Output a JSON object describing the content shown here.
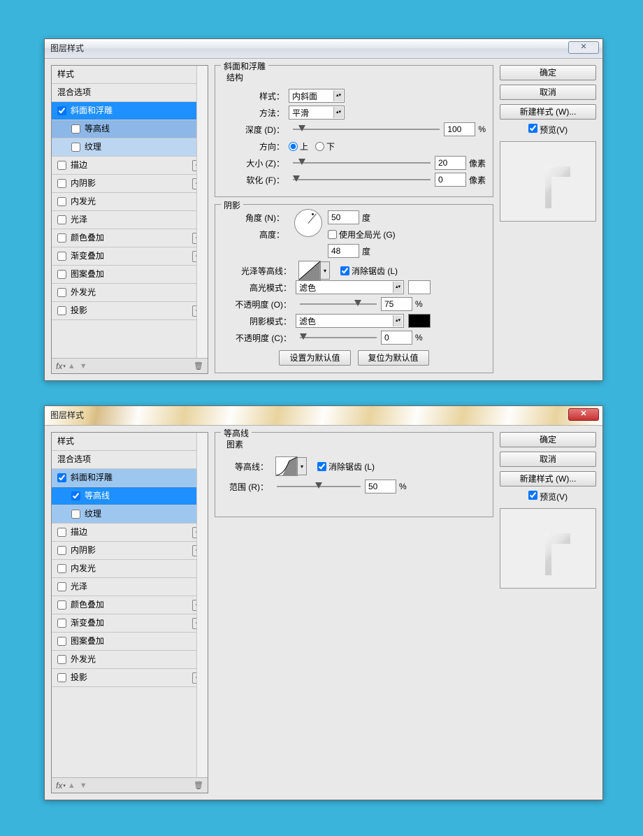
{
  "dialog1": {
    "title": "图层样式",
    "close_symbol": "✕",
    "styles_panel": {
      "header_styles": "样式",
      "header_blend": "混合选项",
      "items": [
        {
          "label": "斜面和浮雕",
          "checked": true,
          "selected": true,
          "indent": false,
          "plus": false
        },
        {
          "label": "等高线",
          "checked": false,
          "selected": false,
          "indent": true,
          "plus": false
        },
        {
          "label": "纹理",
          "checked": false,
          "selected": false,
          "indent": true,
          "plus": false
        },
        {
          "label": "描边",
          "checked": false,
          "plus": true
        },
        {
          "label": "内阴影",
          "checked": false,
          "plus": true
        },
        {
          "label": "内发光",
          "checked": false,
          "plus": false
        },
        {
          "label": "光泽",
          "checked": false,
          "plus": false
        },
        {
          "label": "颜色叠加",
          "checked": false,
          "plus": true
        },
        {
          "label": "渐变叠加",
          "checked": false,
          "plus": true
        },
        {
          "label": "图案叠加",
          "checked": false,
          "plus": false
        },
        {
          "label": "外发光",
          "checked": false,
          "plus": false
        },
        {
          "label": "投影",
          "checked": false,
          "plus": true
        }
      ],
      "fx": "fx"
    },
    "bevel": {
      "fieldset_title": "斜面和浮雕",
      "structure_title": "结构",
      "style_label": "样式：",
      "style_value": "内斜面",
      "method_label": "方法：",
      "method_value": "平滑",
      "depth_label": "深度 (D)：",
      "depth_value": "100",
      "depth_unit": "%",
      "direction_label": "方向：",
      "dir_up": "上",
      "dir_down": "下",
      "size_label": "大小 (Z)：",
      "size_value": "20",
      "size_unit": "像素",
      "soften_label": "软化 (F)：",
      "soften_value": "0",
      "soften_unit": "像素"
    },
    "shade": {
      "fieldset_title": "阴影",
      "angle_label": "角度 (N)：",
      "angle_value": "50",
      "angle_unit": "度",
      "global_light": "使用全局光 (G)",
      "altitude_label": "高度：",
      "altitude_value": "48",
      "altitude_unit": "度",
      "gloss_label": "光泽等高线：",
      "antialias": "消除锯齿 (L)",
      "highlight_mode_label": "高光模式：",
      "highlight_mode_value": "滤色",
      "highlight_color": "#ffffff",
      "highlight_opacity_label": "不透明度 (O)：",
      "highlight_opacity_value": "75",
      "shadow_mode_label": "阴影模式：",
      "shadow_mode_value": "滤色",
      "shadow_color": "#000000",
      "shadow_opacity_label": "不透明度 (C)：",
      "shadow_opacity_value": "0",
      "pct": "%"
    },
    "buttons": {
      "default": "设置为默认值",
      "reset": "复位为默认值"
    },
    "right": {
      "ok": "确定",
      "cancel": "取消",
      "new_style": "新建样式 (W)...",
      "preview": "预览(V)"
    }
  },
  "dialog2": {
    "title": "图层样式",
    "close_symbol": "✕",
    "styles_panel": {
      "header_styles": "样式",
      "header_blend": "混合选项",
      "items": [
        {
          "label": "斜面和浮雕",
          "checked": true,
          "selected": false,
          "indent": false,
          "plus": false,
          "faint": true
        },
        {
          "label": "等高线",
          "checked": true,
          "selected": true,
          "indent": true,
          "plus": false
        },
        {
          "label": "纹理",
          "checked": false,
          "selected": false,
          "indent": true,
          "plus": false,
          "faint": true
        },
        {
          "label": "描边",
          "checked": false,
          "plus": true
        },
        {
          "label": "内阴影",
          "checked": false,
          "plus": true
        },
        {
          "label": "内发光",
          "checked": false,
          "plus": false
        },
        {
          "label": "光泽",
          "checked": false,
          "plus": false
        },
        {
          "label": "颜色叠加",
          "checked": false,
          "plus": true
        },
        {
          "label": "渐变叠加",
          "checked": false,
          "plus": true
        },
        {
          "label": "图案叠加",
          "checked": false,
          "plus": false
        },
        {
          "label": "外发光",
          "checked": false,
          "plus": false
        },
        {
          "label": "投影",
          "checked": false,
          "plus": true
        }
      ],
      "fx": "fx"
    },
    "contour": {
      "fieldset_title": "等高线",
      "elements_title": "图素",
      "contour_label": "等高线：",
      "antialias": "消除锯齿 (L)",
      "range_label": "范围 (R)：",
      "range_value": "50",
      "pct": "%"
    },
    "right": {
      "ok": "确定",
      "cancel": "取消",
      "new_style": "新建样式 (W)...",
      "preview": "预览(V)"
    }
  }
}
